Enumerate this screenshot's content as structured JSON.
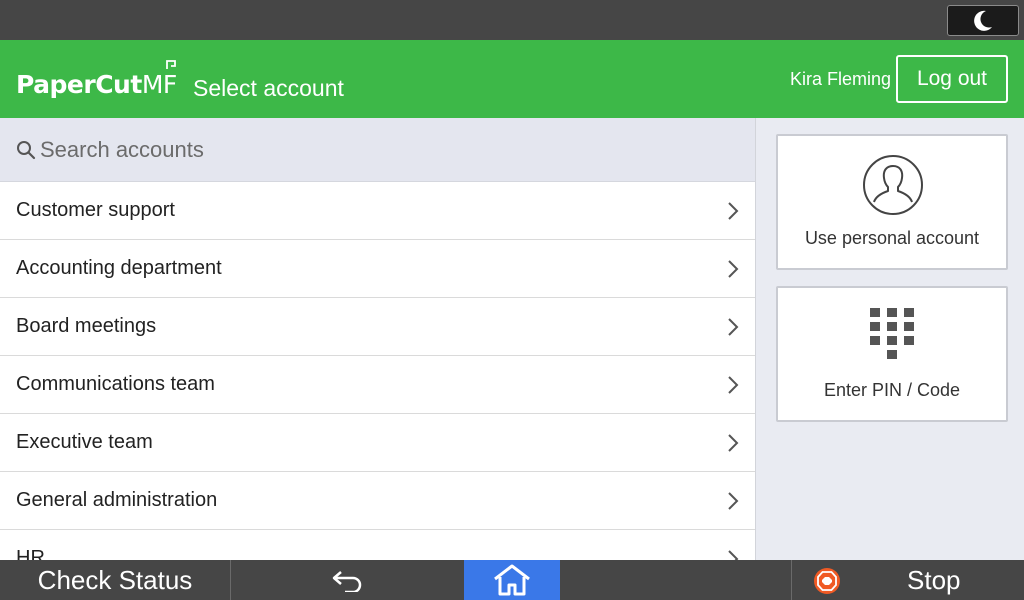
{
  "header": {
    "logo_main": "PaperCut",
    "logo_suffix": "MF",
    "title": "Select account",
    "user_name": "Kira Fleming",
    "logout_label": "Log out"
  },
  "search": {
    "placeholder": "Search accounts",
    "value": ""
  },
  "accounts": [
    {
      "label": "Customer support"
    },
    {
      "label": "Accounting department"
    },
    {
      "label": "Board meetings"
    },
    {
      "label": "Communications team"
    },
    {
      "label": "Executive team"
    },
    {
      "label": "General administration"
    },
    {
      "label": "HR"
    }
  ],
  "tiles": {
    "personal_label": "Use personal account",
    "pin_label": "Enter PIN / Code"
  },
  "bottom": {
    "check_status": "Check Status",
    "stop": "Stop"
  },
  "colors": {
    "brand_green": "#3db848",
    "home_blue": "#3a78e8",
    "stop_orange": "#f05a24"
  },
  "icons": [
    "moon-icon",
    "search-icon",
    "chevron-right-icon",
    "person-icon",
    "keypad-icon",
    "back-arrow-icon",
    "home-icon",
    "stop-icon"
  ]
}
